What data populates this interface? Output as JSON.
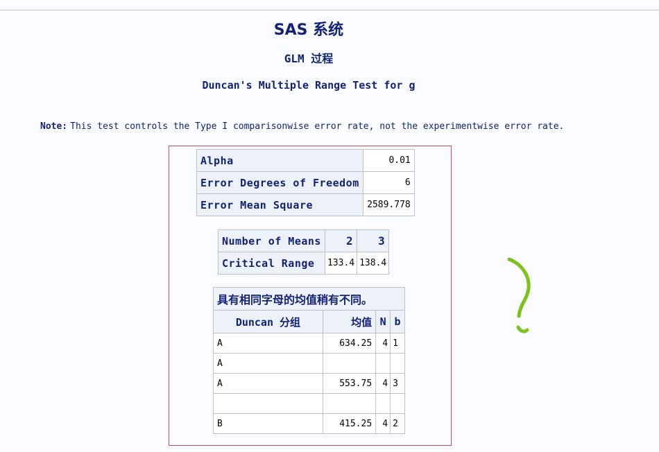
{
  "header": {
    "title": "SAS 系统",
    "procedure": "GLM 过程",
    "test_title": "Duncan's Multiple Range Test for g"
  },
  "note": {
    "label": "Note:",
    "text": "This test controls the Type I comparisonwise error rate, not the experimentwise error rate."
  },
  "params": [
    {
      "label": "Alpha",
      "value": "0.01"
    },
    {
      "label": "Error Degrees of Freedom",
      "value": "6"
    },
    {
      "label": "Error Mean Square",
      "value": "2589.778"
    }
  ],
  "range": {
    "means_label": "Number of Means",
    "means": [
      "2",
      "3"
    ],
    "critical_label": "Critical Range",
    "critical": [
      "133.4",
      "138.4"
    ]
  },
  "groups": {
    "caption": "具有相同字母的均值稍有不同。",
    "headers": [
      "Duncan 分组",
      "均值",
      "N",
      "b"
    ],
    "rows": [
      {
        "group": "A",
        "mean": "634.25",
        "n": "4",
        "b": "1"
      },
      {
        "group": "A",
        "mean": "",
        "n": "",
        "b": ""
      },
      {
        "group": "A",
        "mean": "553.75",
        "n": "4",
        "b": "3"
      },
      {
        "group": "",
        "mean": "",
        "n": "",
        "b": ""
      },
      {
        "group": "B",
        "mean": "415.25",
        "n": "4",
        "b": "2"
      }
    ]
  },
  "annotation": {
    "color": "#7cc21a",
    "highlight_color": "#d9485f"
  }
}
